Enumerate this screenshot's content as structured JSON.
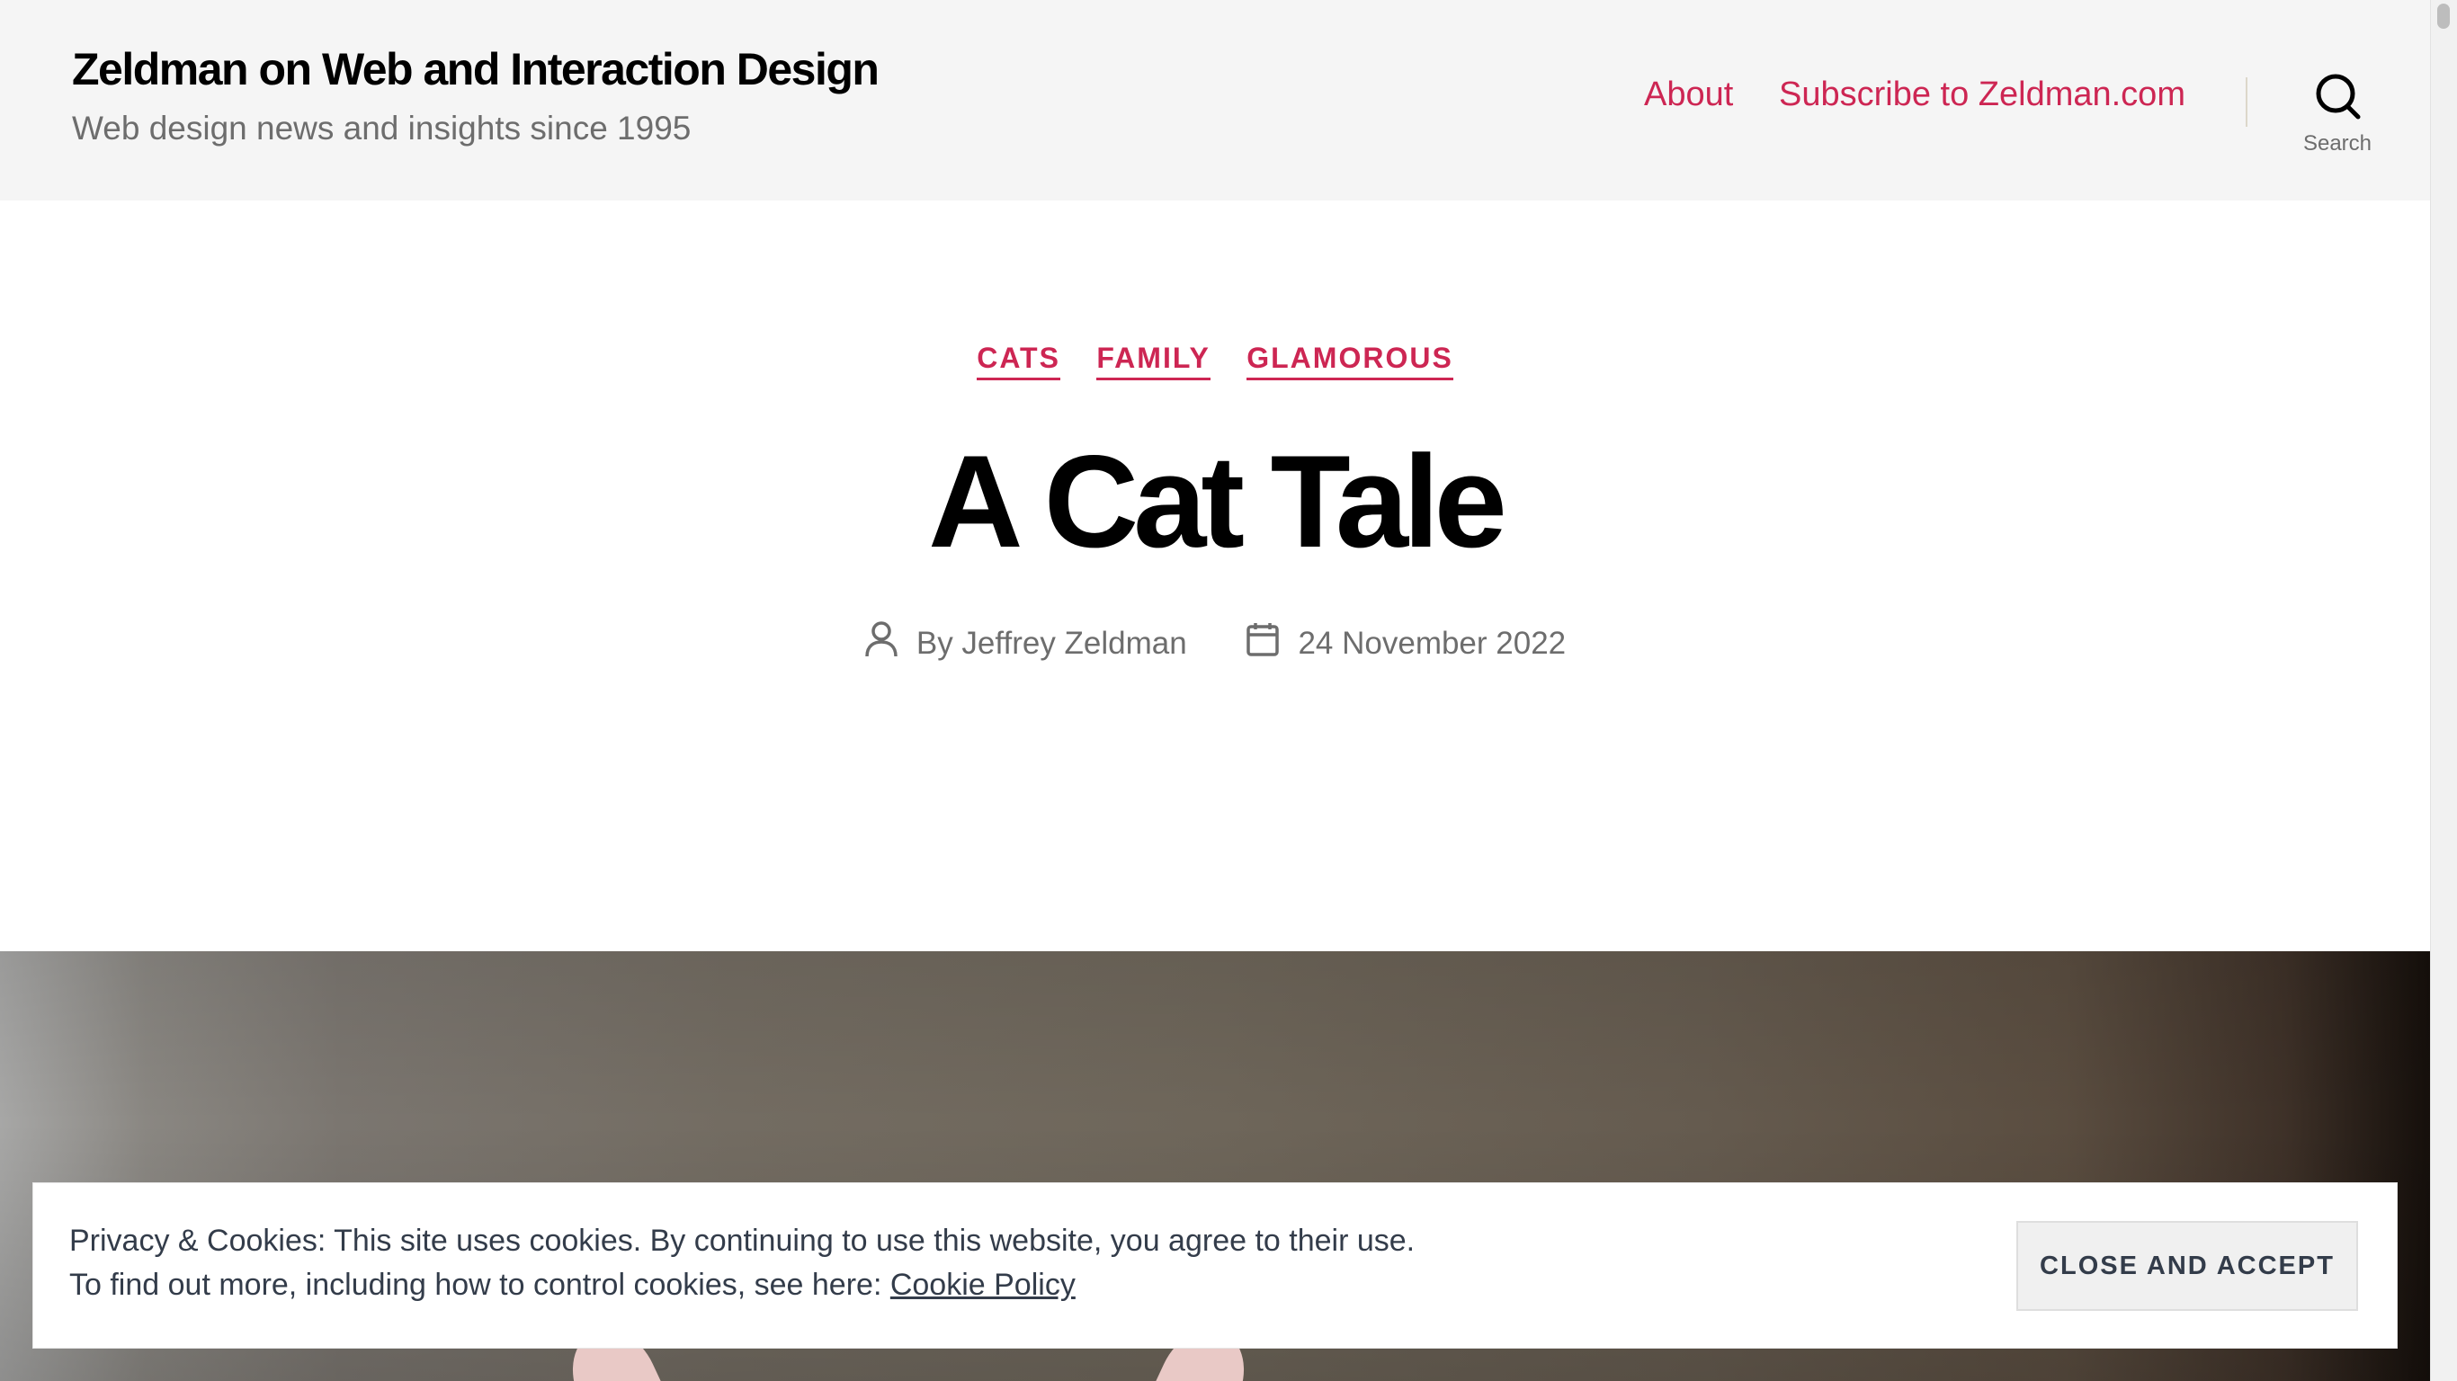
{
  "site": {
    "title": "Zeldman on Web and Interaction Design",
    "description": "Web design news and insights since 1995"
  },
  "nav": {
    "items": [
      {
        "label": "About"
      },
      {
        "label": "Subscribe to Zeldman.com"
      }
    ],
    "search_label": "Search"
  },
  "post": {
    "categories": [
      "CATS",
      "FAMILY",
      "GLAMOROUS"
    ],
    "title": "A Cat Tale",
    "author": "By Jeffrey Zeldman",
    "date": "24 November 2022"
  },
  "cookie": {
    "line1": "Privacy & Cookies: This site uses cookies. By continuing to use this website, you agree to their use.",
    "line2": "To find out more, including how to control cookies, see here: ",
    "link": "Cookie Policy",
    "button": "CLOSE AND ACCEPT"
  },
  "icons": {
    "search": "search-icon",
    "author": "user-icon",
    "date": "calendar-icon"
  },
  "colors": {
    "accent": "#cd2653",
    "header_bg": "#f5f5f5",
    "meta_text": "#6d6d6d",
    "cookie_text": "#333c4a"
  }
}
